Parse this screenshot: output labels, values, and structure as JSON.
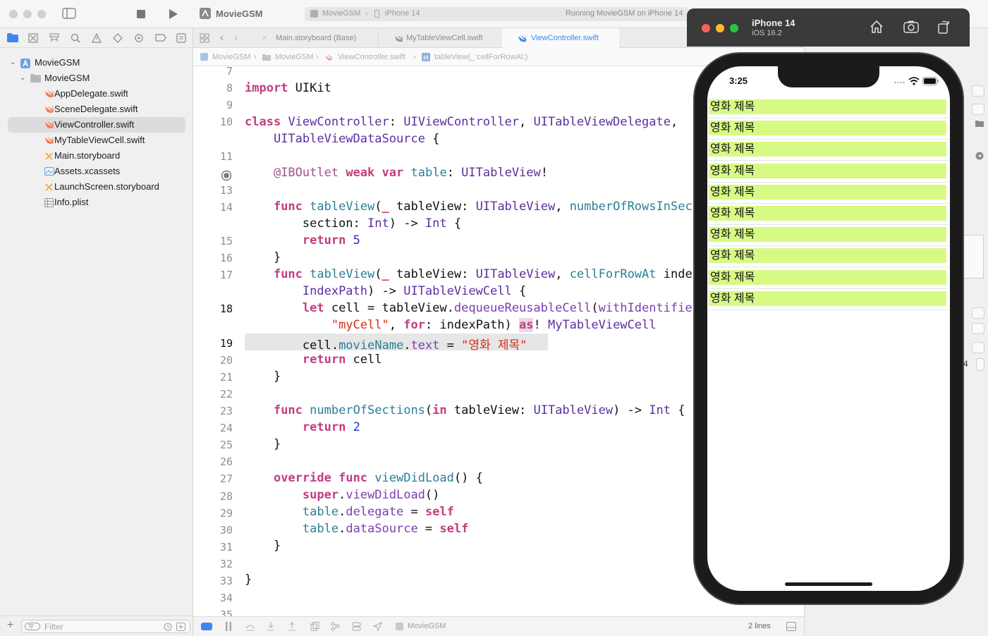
{
  "toolbar": {
    "project_name": "MovieGSM",
    "scheme": "MovieGSM",
    "destination": "iPhone 14",
    "status": "Running MovieGSM on iPhone 14"
  },
  "navigator": {
    "items": [
      {
        "label": "MovieGSM",
        "kind": "project"
      },
      {
        "label": "MovieGSM",
        "kind": "folder"
      },
      {
        "label": "AppDelegate.swift",
        "kind": "swift"
      },
      {
        "label": "SceneDelegate.swift",
        "kind": "swift"
      },
      {
        "label": "ViewController.swift",
        "kind": "swift"
      },
      {
        "label": "MyTableViewCell.swift",
        "kind": "swift"
      },
      {
        "label": "Main.storyboard",
        "kind": "storyboard"
      },
      {
        "label": "Assets.xcassets",
        "kind": "assets"
      },
      {
        "label": "LaunchScreen.storyboard",
        "kind": "storyboard"
      },
      {
        "label": "Info.plist",
        "kind": "plist"
      }
    ],
    "selected_index": 4,
    "filter_placeholder": "Filter"
  },
  "tabs": [
    {
      "label": "Main.storyboard (Base)"
    },
    {
      "label": "MyTableViewCell.swift"
    },
    {
      "label": "ViewController.swift"
    }
  ],
  "active_tab_index": 2,
  "jumpbar": {
    "crumbs": [
      "MovieGSM",
      "MovieGSM",
      "ViewController.swift",
      "tableView(_:cellForRowAt:)"
    ]
  },
  "editor": {
    "line_numbers": [
      "7",
      "8",
      "9",
      "10",
      "",
      "11",
      "12",
      "13",
      "14",
      "",
      "15",
      "16",
      "17",
      "",
      "18",
      "",
      "19",
      "20",
      "21",
      "22",
      "23",
      "24",
      "25",
      "26",
      "27",
      "28",
      "29",
      "30",
      "31",
      "32",
      "33",
      "34",
      "35"
    ],
    "breakpoint_line": "12",
    "current_lines": [
      "18",
      "19"
    ]
  },
  "debug": {
    "target": "MovieGSM",
    "line_count": "2 lines"
  },
  "simulator": {
    "device": "iPhone 14",
    "os": "iOS 16.2",
    "time": "3:25",
    "cell_text": "영화 제목",
    "cell_color": "#d7fa85",
    "cell_count": 10
  },
  "inspector": {
    "stepper_value": "4"
  },
  "colors": {
    "accent": "#3b87f0",
    "keyword": "#c33d7f",
    "string": "#d12f1b",
    "number": "#2334c9"
  }
}
